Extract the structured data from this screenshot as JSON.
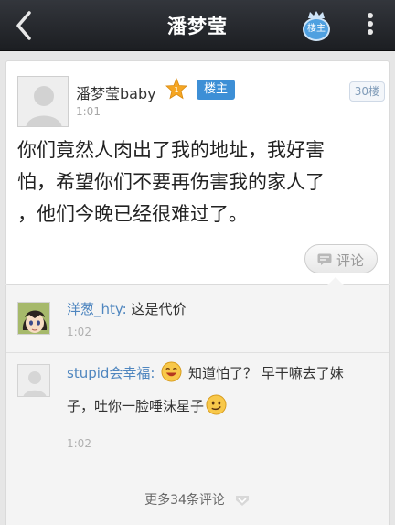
{
  "header": {
    "title": "潘梦莹",
    "host_button_label": "楼主"
  },
  "post": {
    "author": "潘梦莹baby",
    "level": "1",
    "host_tag": "楼主",
    "time": "1:01",
    "floor": "30楼",
    "lines": [
      "你们竟然人肉出了我的地址，我好害",
      "怕，希望你们不要再伤害我的家人了",
      "，他们今晚已经很难过了。"
    ],
    "comment_label": "评论"
  },
  "replies": [
    {
      "user": "洋葱_hty:",
      "text": " 这是代价",
      "time": "1:02"
    },
    {
      "user": "stupid会幸福:",
      "text_a": " 知道怕了？ 早干嘛去了妹",
      "text_b": "子，吐你一脸唾沫星子",
      "time": "1:02"
    }
  ],
  "more_comments": "更多34条评论",
  "colors": {
    "accent": "#3d8fd6",
    "username": "#4f86bf",
    "navbar": "#25282d"
  }
}
